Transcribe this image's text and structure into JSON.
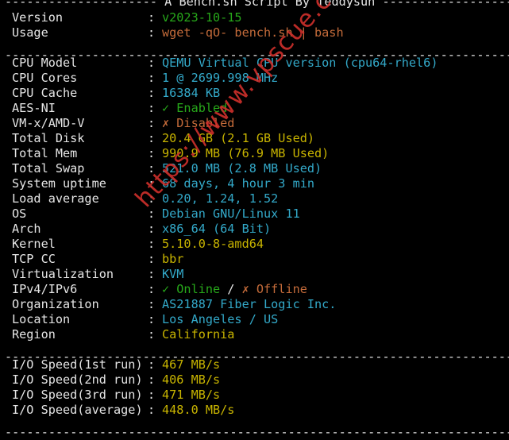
{
  "colors": {
    "label": "#e6e6e6",
    "yellow": "#c8b400",
    "cyan": "#33a9c9",
    "green": "#27a81a",
    "orange": "#c46b3a",
    "watermark": "#d0302c"
  },
  "header": {
    "title_line": "--------------------- A Bench.sh Script By Teddysun --------------------"
  },
  "intro": [
    {
      "label": "Version",
      "value": "v2023-10-15",
      "color": "green"
    },
    {
      "label": "Usage",
      "value": "wget -qO- bench.sh | bash",
      "color": "orange"
    }
  ],
  "separator": "------------------------------------------------------------------------",
  "system": [
    {
      "label": "CPU Model",
      "value": "QEMU Virtual CPU version (cpu64-rhel6)",
      "color": "cyan"
    },
    {
      "label": "CPU Cores",
      "value": "1 @ 2699.998 MHz",
      "color": "cyan"
    },
    {
      "label": "CPU Cache",
      "value": "16384 KB",
      "color": "cyan"
    },
    {
      "label": "AES-NI",
      "value": "✓ Enabled",
      "color": "green"
    },
    {
      "label": "VM-x/AMD-V",
      "value": "✗ Disabled",
      "color": "orange"
    },
    {
      "label": "Total Disk",
      "value": "20.4 GB (2.1 GB Used)",
      "color": "yellow"
    },
    {
      "label": "Total Mem",
      "value": "990.9 MB (76.9 MB Used)",
      "color": "yellow"
    },
    {
      "label": "Total Swap",
      "value": "521.0 MB (2.8 MB Used)",
      "color": "cyan"
    },
    {
      "label": "System uptime",
      "value": "68 days, 4 hour 3 min",
      "color": "cyan"
    },
    {
      "label": "Load average",
      "value": "0.20, 1.24, 1.52",
      "color": "cyan"
    },
    {
      "label": "OS",
      "value": "Debian GNU/Linux 11",
      "color": "cyan"
    },
    {
      "label": "Arch",
      "value": "x86_64 (64 Bit)",
      "color": "cyan"
    },
    {
      "label": "Kernel",
      "value": "5.10.0-8-amd64",
      "color": "yellow"
    },
    {
      "label": "TCP CC",
      "value": "bbr",
      "color": "yellow"
    },
    {
      "label": "Virtualization",
      "value": "KVM",
      "color": "cyan"
    }
  ],
  "ip": {
    "label": "IPv4/IPv6",
    "online": "✓ Online",
    "slash": " / ",
    "offline": "✗ Offline"
  },
  "location": [
    {
      "label": "Organization",
      "value": "AS21887 Fiber Logic Inc.",
      "color": "cyan"
    },
    {
      "label": "Location",
      "value": "Los Angeles / US",
      "color": "cyan"
    },
    {
      "label": "Region",
      "value": "California",
      "color": "yellow"
    }
  ],
  "io": [
    {
      "label": "I/O Speed(1st run)",
      "value": "467 MB/s",
      "color": "yellow"
    },
    {
      "label": "I/O Speed(2nd run)",
      "value": "406 MB/s",
      "color": "yellow"
    },
    {
      "label": "I/O Speed(3rd run)",
      "value": "471 MB/s",
      "color": "yellow"
    },
    {
      "label": "I/O Speed(average)",
      "value": "448.0 MB/s",
      "color": "yellow"
    }
  ],
  "watermark": "https://www.vpscue.com"
}
